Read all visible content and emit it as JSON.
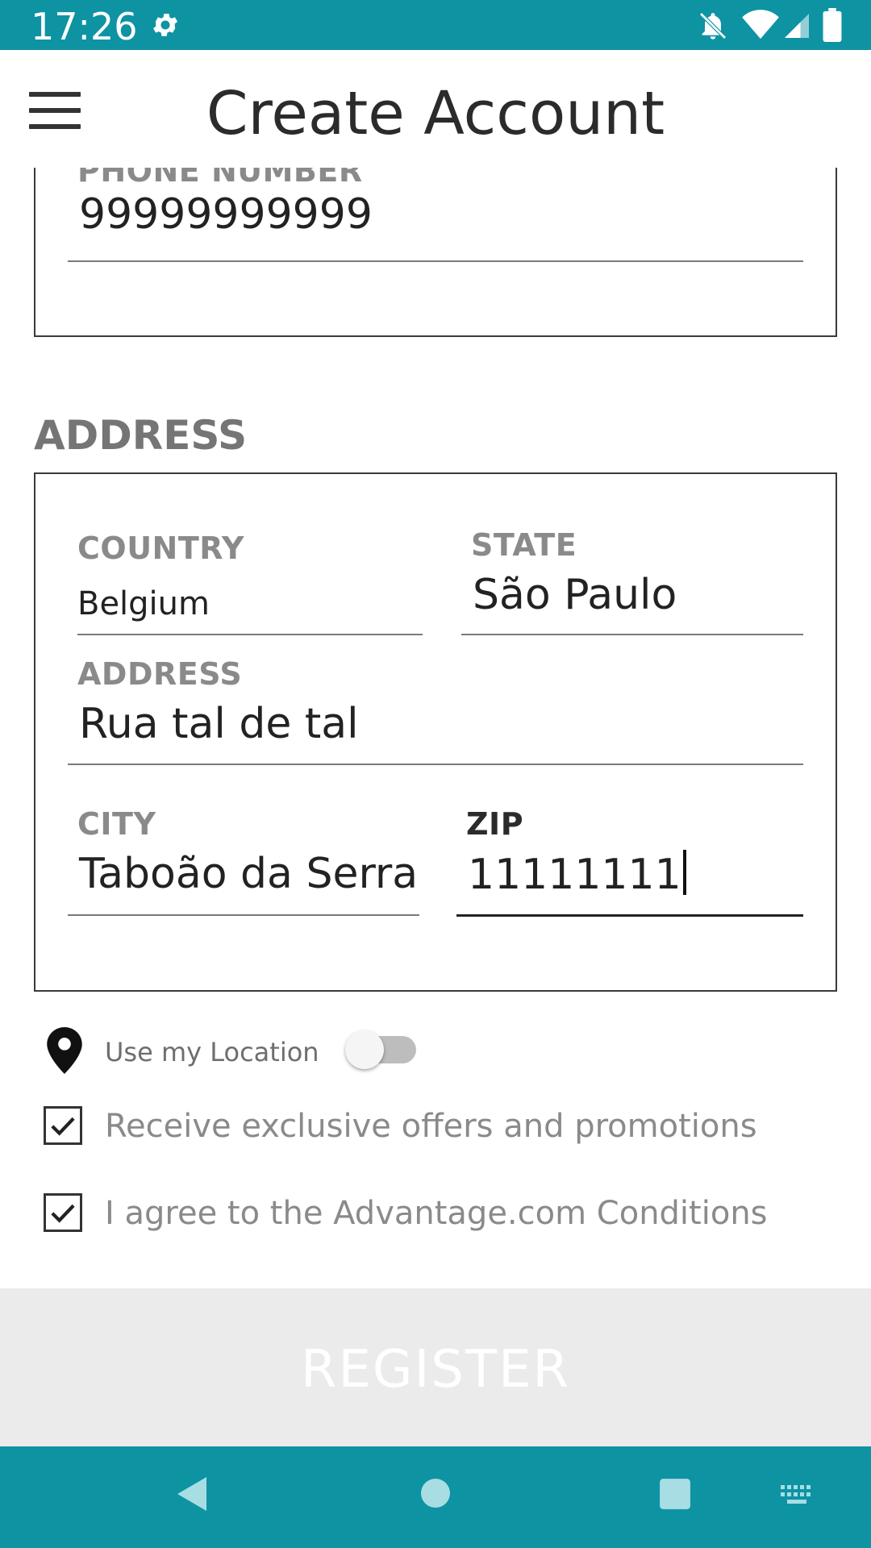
{
  "status_bar": {
    "time": "17:26",
    "icons": [
      "settings-icon",
      "notifications-off-icon",
      "wifi-icon",
      "cell-signal-icon",
      "battery-icon"
    ]
  },
  "app_bar": {
    "title": "Create Account",
    "menu_icon": "hamburger-menu-icon"
  },
  "contact": {
    "phone_label": "PHONE NUMBER",
    "phone_value": "99999999999"
  },
  "address": {
    "section_title": "ADDRESS",
    "country_label": "COUNTRY",
    "country_value": "Belgium",
    "state_label": "STATE",
    "state_value": "São Paulo",
    "address_label": "ADDRESS",
    "address_value": "Rua tal de tal",
    "city_label": "CITY",
    "city_value": "Taboão da Serra",
    "zip_label": "ZIP",
    "zip_value": "11111111"
  },
  "options": {
    "location_label": "Use my Location",
    "location_enabled": false,
    "offers_label": "Receive exclusive offers and promotions",
    "offers_checked": true,
    "conditions_label": "I agree to the Advantage.com Conditions",
    "conditions_checked": true
  },
  "register": {
    "label": "REGISTER"
  },
  "nav_bar": {
    "icons": [
      "back-icon",
      "home-icon",
      "recents-icon",
      "keyboard-icon"
    ]
  },
  "colors": {
    "accent": "#0e93a3",
    "register_bg": "#ebebeb",
    "label_gray": "#8a8a8a"
  }
}
